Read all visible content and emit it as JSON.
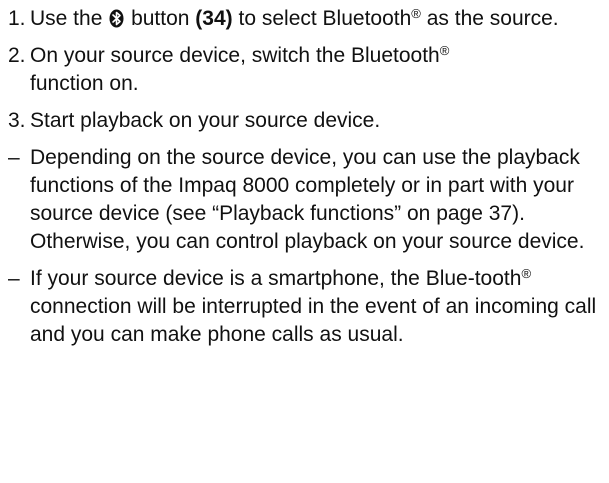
{
  "steps": [
    {
      "marker": "1.",
      "pre": "Use the",
      "icon": "bluetooth-icon",
      "mid": "button",
      "bold": "(34)",
      "post": "to select Bluetooth",
      "sup": "®",
      "post2": "as the source."
    },
    {
      "marker": "2.",
      "pre": "On your source device, switch the Bluetooth",
      "sup": "®",
      "post": "function on."
    },
    {
      "marker": "3.",
      "text": "Start playback on your source device."
    }
  ],
  "notes": [
    {
      "marker": "–",
      "text": "Depending on the source device, you can use the playback functions of the Impaq 8000 completely or in part with your source device (see “Playback functions” on page 37). Otherwise, you can control playback on your source device."
    },
    {
      "marker": "–",
      "pre": "If your source device is a smartphone, the Blue-tooth",
      "sup": "®",
      "post": "connection will be interrupted in the event of an incoming call and you can make phone calls as usual."
    }
  ]
}
